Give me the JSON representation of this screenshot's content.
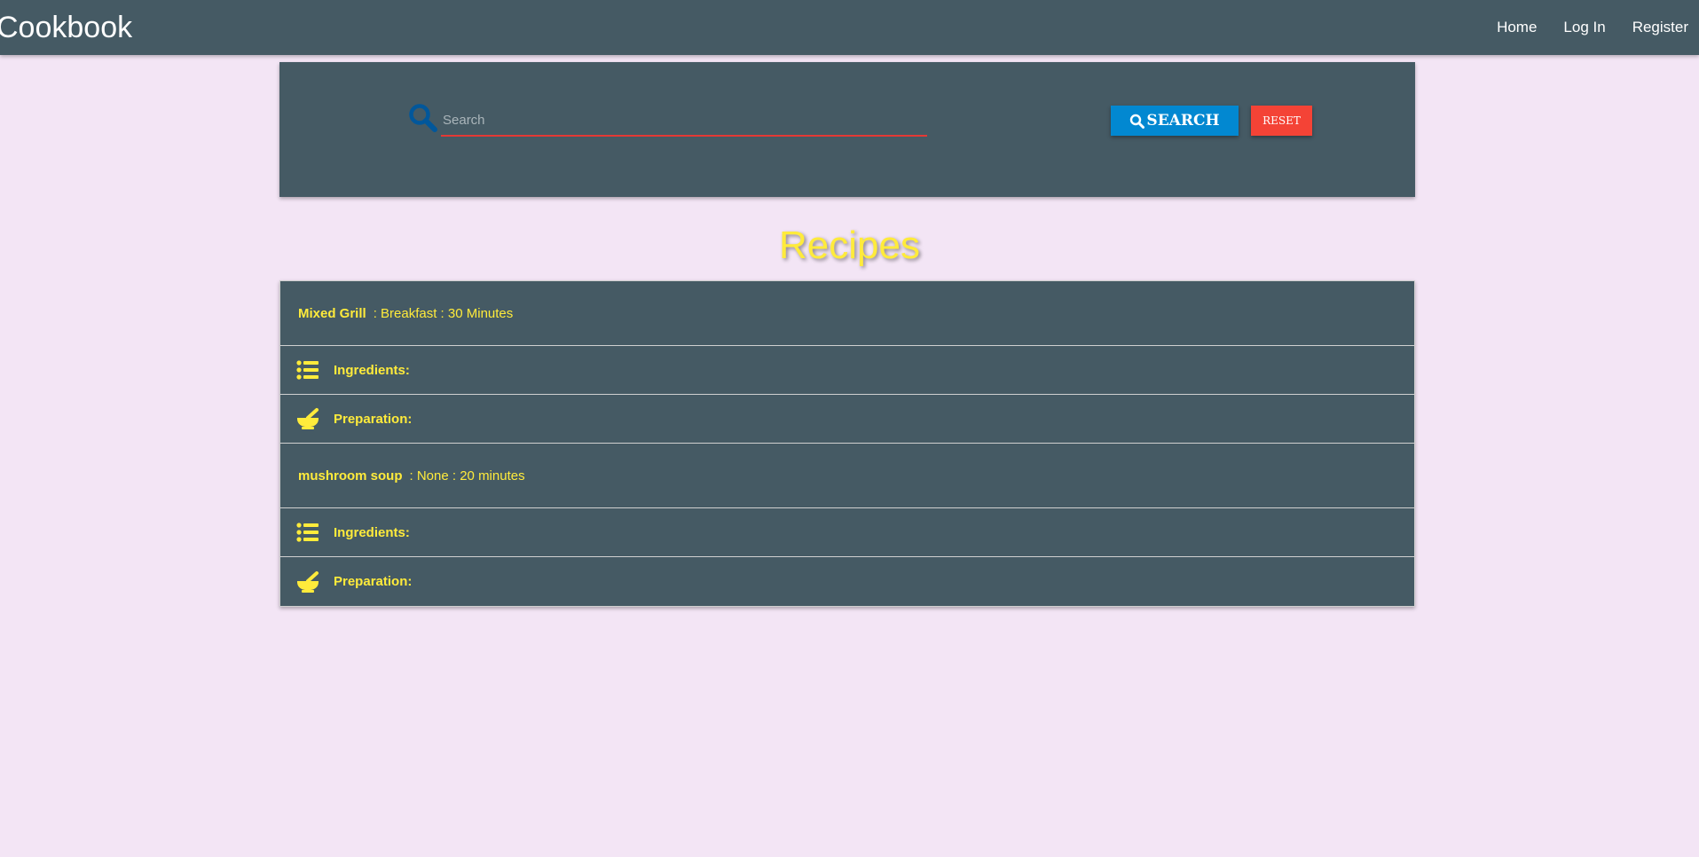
{
  "navbar": {
    "brand": "Cookbook",
    "links": [
      "Home",
      "Log In",
      "Register"
    ]
  },
  "search": {
    "placeholder": "Search",
    "value": "",
    "search_button_label": "SEARCH",
    "reset_button_label": "RESET",
    "icon": "search-icon"
  },
  "heading": "Recipes",
  "recipes": [
    {
      "name": "Mixed Grill",
      "details": ": Breakfast : 30 Minutes",
      "ingredients_label": "Ingredients:",
      "preparation_label": "Preparation:"
    },
    {
      "name": "mushroom soup",
      "details": ": None : 20 minutes",
      "ingredients_label": "Ingredients:",
      "preparation_label": "Preparation:"
    }
  ],
  "colors": {
    "background": "#f3e5f5",
    "panel": "#455a64",
    "accent_text": "#ffeb3b",
    "search_button": "#0288d1",
    "reset_button": "#f44336",
    "input_underline": "#e53935"
  }
}
